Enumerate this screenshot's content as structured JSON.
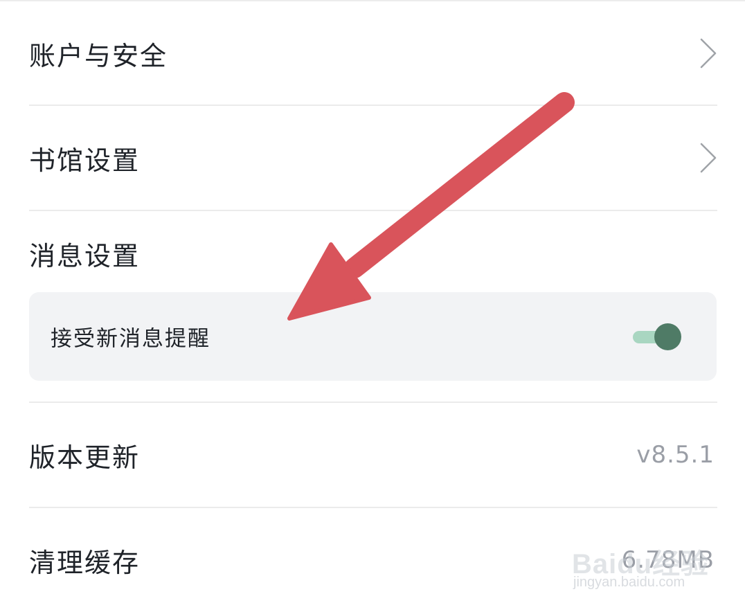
{
  "settings": {
    "account_security": "账户与安全",
    "library_settings": "书馆设置",
    "message_settings": "消息设置",
    "receive_new_message": "接受新消息提醒",
    "version_update": "版本更新",
    "version_value": "v8.5.1",
    "clear_cache": "清理缓存",
    "cache_value": "6.78MB",
    "new_message_toggle_on": true
  },
  "watermark": {
    "brand": "Baidu经验",
    "site": "jingyan.baidu.com"
  },
  "colors": {
    "annotation_arrow": "#d9545b",
    "toggle_track": "#a9d6c1",
    "toggle_knob": "#4f7b66",
    "sub_card_bg": "#f2f3f5"
  },
  "icons": {
    "row_chevron": "chevron-right-icon",
    "annotation": "red-arrow-icon"
  }
}
